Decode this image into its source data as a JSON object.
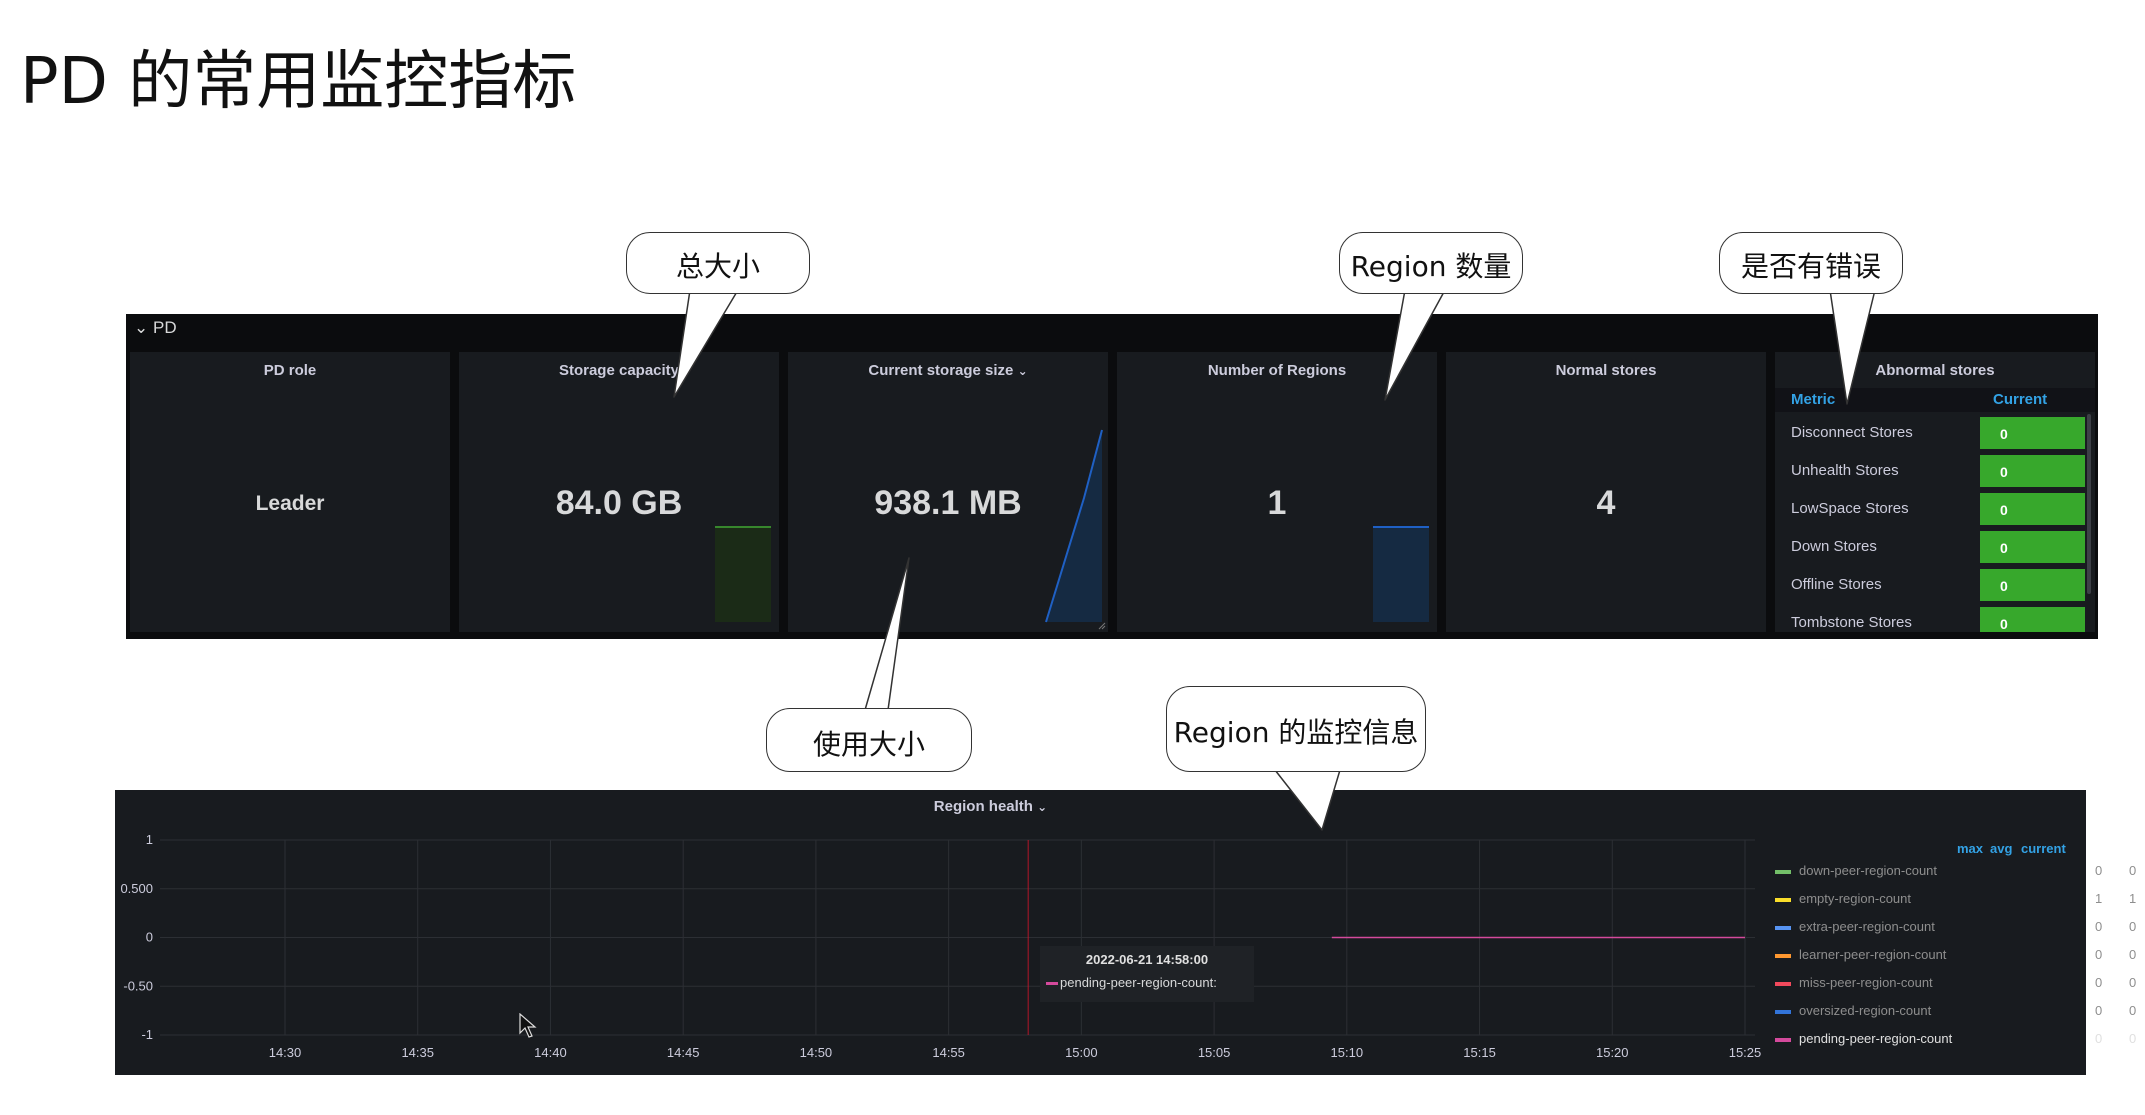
{
  "page": {
    "title": "PD 的常用监控指标"
  },
  "pd_row": {
    "header": "PD",
    "panels": {
      "pd_role": {
        "title": "PD role",
        "value": "Leader"
      },
      "storage_capacity": {
        "title": "Storage capacity",
        "value": "84.0 GB"
      },
      "current_storage_size": {
        "title": "Current storage size",
        "value": "938.1 MB"
      },
      "number_of_regions": {
        "title": "Number of Regions",
        "value": "1"
      },
      "normal_stores": {
        "title": "Normal stores",
        "value": "4"
      },
      "abnormal_stores": {
        "title": "Abnormal stores",
        "col_metric": "Metric",
        "col_current": "Current",
        "rows": [
          {
            "label": "Disconnect Stores",
            "value": "0"
          },
          {
            "label": "Unhealth Stores",
            "value": "0"
          },
          {
            "label": "LowSpace Stores",
            "value": "0"
          },
          {
            "label": "Down Stores",
            "value": "0"
          },
          {
            "label": "Offline Stores",
            "value": "0"
          },
          {
            "label": "Tombstone Stores",
            "value": "0"
          }
        ]
      }
    }
  },
  "callouts": {
    "total_size": "总大小",
    "region_count": "Region 数量",
    "has_error": "是否有错误",
    "used_size": "使用大小",
    "region_monitor": "Region 的监控信息"
  },
  "region_health": {
    "title": "Region health",
    "legend_columns": {
      "max": "max",
      "avg": "avg",
      "current": "current"
    },
    "tooltip": {
      "time": "2022-06-21 14:58:00",
      "series": "pending-peer-region-count:"
    },
    "colors": {
      "grid": "#2c2f34",
      "marker": "#c4162a",
      "pending": "#d44a9c"
    }
  },
  "chart_data": {
    "type": "line",
    "title": "Region health",
    "x": [
      "14:30",
      "14:35",
      "14:40",
      "14:45",
      "14:50",
      "14:55",
      "15:00",
      "15:05",
      "15:10",
      "15:15",
      "15:20",
      "15:25"
    ],
    "y_ticks": [
      "1",
      "0.500",
      "0",
      "-0.50",
      "-1"
    ],
    "ylim": [
      -1,
      1
    ],
    "grid": true,
    "legend_placement": "right",
    "series": [
      {
        "name": "down-peer-region-count",
        "color": "#73bf69",
        "max": "0",
        "avg": "0",
        "current": "0"
      },
      {
        "name": "empty-region-count",
        "color": "#fade2a",
        "max": "1",
        "avg": "1",
        "current": "1"
      },
      {
        "name": "extra-peer-region-count",
        "color": "#5794f2",
        "max": "0",
        "avg": "0",
        "current": "0"
      },
      {
        "name": "learner-peer-region-count",
        "color": "#ff9830",
        "max": "0",
        "avg": "0",
        "current": "0"
      },
      {
        "name": "miss-peer-region-count",
        "color": "#f2495c",
        "max": "0",
        "avg": "0",
        "current": "0"
      },
      {
        "name": "oversized-region-count",
        "color": "#3274d9",
        "max": "0",
        "avg": "0",
        "current": "0"
      },
      {
        "name": "pending-peer-region-count",
        "color": "#d44a9c",
        "max": "0",
        "avg": "0",
        "current": "0",
        "points": [
          [
            "15:10",
            0
          ],
          [
            "15:15",
            0
          ],
          [
            "15:20",
            0
          ],
          [
            "15:25",
            0
          ]
        ]
      }
    ],
    "marker_x": "14:58"
  }
}
